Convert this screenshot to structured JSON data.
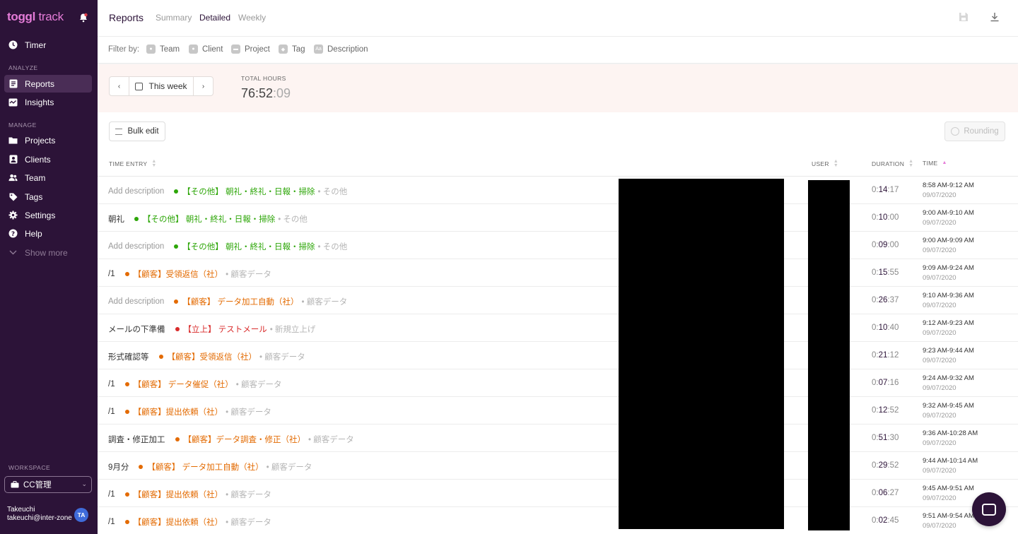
{
  "app": {
    "logo_bold": "toggl",
    "logo_light": " track"
  },
  "sidebar": {
    "timer_label": "Timer",
    "analyze_label": "ANALYZE",
    "reports_label": "Reports",
    "insights_label": "Insights",
    "manage_label": "MANAGE",
    "projects_label": "Projects",
    "clients_label": "Clients",
    "team_label": "Team",
    "tags_label": "Tags",
    "settings_label": "Settings",
    "help_label": "Help",
    "show_more_label": "Show more",
    "workspace_label": "WORKSPACE",
    "workspace_name": "CC管理",
    "user_name": "Takeuchi",
    "user_email": "takeuchi@inter-zone...",
    "user_initials": "TA"
  },
  "header": {
    "title": "Reports",
    "tabs": [
      "Summary",
      "Detailed",
      "Weekly"
    ],
    "active_tab": "Detailed"
  },
  "filters": {
    "label": "Filter by:",
    "items": [
      "Team",
      "Client",
      "Project",
      "Tag",
      "Description"
    ]
  },
  "summary": {
    "range_label": "This week",
    "total_label": "TOTAL HOURS",
    "total_hm": "76:52",
    "total_sec": ":09"
  },
  "toolbar": {
    "bulk_edit_label": "Bulk edit",
    "rounding_label": "Rounding"
  },
  "table": {
    "headers": {
      "entry": "TIME ENTRY",
      "user": "USER",
      "duration": "DURATION",
      "time": "TIME"
    },
    "rows": [
      {
        "desc": "Add description",
        "empty": true,
        "project": "【その他】 朝礼・終礼・日報・掃除",
        "client": "• その他",
        "color": "#2da608",
        "dur_h": "0:",
        "dur_m": "14",
        "dur_s": ":17",
        "time": "8:58 AM-9:12 AM",
        "date": "09/07/2020"
      },
      {
        "desc": "朝礼",
        "empty": false,
        "project": "【その他】 朝礼・終礼・日報・掃除",
        "client": "• その他",
        "color": "#2da608",
        "dur_h": "0:",
        "dur_m": "10",
        "dur_s": ":00",
        "time": "9:00 AM-9:10 AM",
        "date": "09/07/2020"
      },
      {
        "desc": "Add description",
        "empty": true,
        "project": "【その他】 朝礼・終礼・日報・掃除",
        "client": "• その他",
        "color": "#2da608",
        "dur_h": "0:",
        "dur_m": "09",
        "dur_s": ":00",
        "time": "9:00 AM-9:09 AM",
        "date": "09/07/2020"
      },
      {
        "desc": "/1",
        "empty": false,
        "project": "【顧客】受領返信（社）",
        "client": "• 顧客データ",
        "color": "#e36a00",
        "dur_h": "0:",
        "dur_m": "15",
        "dur_s": ":55",
        "time": "9:09 AM-9:24 AM",
        "date": "09/07/2020"
      },
      {
        "desc": "Add description",
        "empty": true,
        "project": "【顧客】 データ加工自動（社）",
        "client": "• 顧客データ",
        "color": "#e36a00",
        "dur_h": "0:",
        "dur_m": "26",
        "dur_s": ":37",
        "time": "9:10 AM-9:36 AM",
        "date": "09/07/2020"
      },
      {
        "desc": "メールの下準備",
        "empty": false,
        "project": "【立上】 テストメール",
        "client": "• 新規立上げ",
        "color": "#d92b2b",
        "dur_h": "0:",
        "dur_m": "10",
        "dur_s": ":40",
        "time": "9:12 AM-9:23 AM",
        "date": "09/07/2020"
      },
      {
        "desc": "形式確認等",
        "empty": false,
        "project": "【顧客】受領返信（社）",
        "client": "• 顧客データ",
        "color": "#e36a00",
        "dur_h": "0:",
        "dur_m": "21",
        "dur_s": ":12",
        "time": "9:23 AM-9:44 AM",
        "date": "09/07/2020"
      },
      {
        "desc": "/1",
        "empty": false,
        "project": "【顧客】 データ催促（社）",
        "client": "• 顧客データ",
        "color": "#e36a00",
        "dur_h": "0:",
        "dur_m": "07",
        "dur_s": ":16",
        "time": "9:24 AM-9:32 AM",
        "date": "09/07/2020"
      },
      {
        "desc": "/1",
        "empty": false,
        "project": "【顧客】提出依頼（社）",
        "client": "• 顧客データ",
        "color": "#e36a00",
        "dur_h": "0:",
        "dur_m": "12",
        "dur_s": ":52",
        "time": "9:32 AM-9:45 AM",
        "date": "09/07/2020"
      },
      {
        "desc": "調査・修正加工",
        "empty": false,
        "project": "【顧客】データ調査・修正（社）",
        "client": "• 顧客データ",
        "color": "#e36a00",
        "dur_h": "0:",
        "dur_m": "51",
        "dur_s": ":30",
        "time": "9:36 AM-10:28 AM",
        "date": "09/07/2020"
      },
      {
        "desc": "9月分",
        "empty": false,
        "project": "【顧客】 データ加工自動（社）",
        "client": "• 顧客データ",
        "color": "#e36a00",
        "dur_h": "0:",
        "dur_m": "29",
        "dur_s": ":52",
        "time": "9:44 AM-10:14 AM",
        "date": "09/07/2020"
      },
      {
        "desc": "/1",
        "empty": false,
        "project": "【顧客】提出依頼（社）",
        "client": "• 顧客データ",
        "color": "#e36a00",
        "dur_h": "0:",
        "dur_m": "06",
        "dur_s": ":27",
        "time": "9:45 AM-9:51 AM",
        "date": "09/07/2020"
      },
      {
        "desc": "/1",
        "empty": false,
        "project": "【顧客】提出依頼（社）",
        "client": "• 顧客データ",
        "color": "#e36a00",
        "dur_h": "0:",
        "dur_m": "02",
        "dur_s": ":45",
        "time": "9:51 AM-9:54 AM",
        "date": "09/07/2020"
      }
    ]
  },
  "colors": {
    "sidebar_bg": "#2c1338",
    "accent": "#e57cd8",
    "green_project": "#2da608",
    "orange_project": "#e36a00",
    "red_project": "#d92b2b"
  }
}
